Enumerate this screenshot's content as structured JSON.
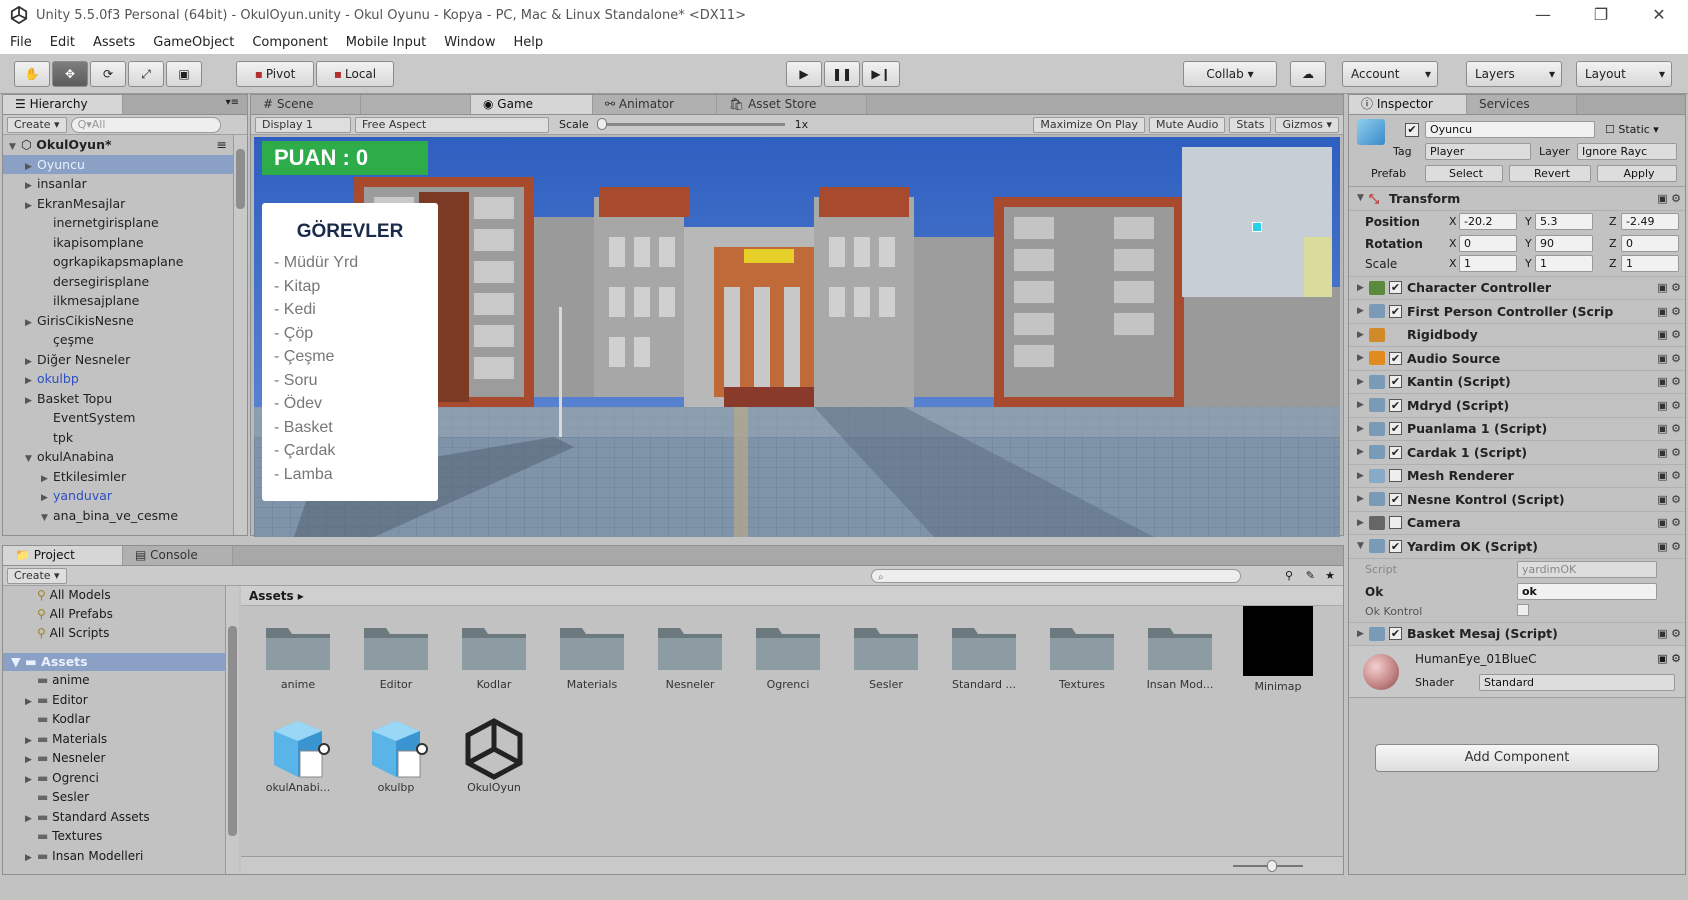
{
  "window": {
    "title": "Unity 5.5.0f3 Personal (64bit) - OkulOyun.unity - Okul Oyunu - Kopya - PC, Mac & Linux Standalone* <DX11>"
  },
  "menu": [
    "File",
    "Edit",
    "Assets",
    "GameObject",
    "Component",
    "Mobile Input",
    "Window",
    "Help"
  ],
  "toolbar": {
    "pivot": "Pivot",
    "local": "Local",
    "collab": "Collab ▾",
    "account": "Account",
    "layers": "Layers",
    "layout": "Layout"
  },
  "hierarchy": {
    "tab": "Hierarchy",
    "create": "Create ▾",
    "search_placeholder": "Q▾All",
    "root": "OkulOyun*",
    "items": [
      {
        "label": "Oyuncu",
        "tri": "▶",
        "indent": 1,
        "state": "sel"
      },
      {
        "label": "insanlar",
        "tri": "▶",
        "indent": 1,
        "state": ""
      },
      {
        "label": "EkranMesajlar",
        "tri": "▶",
        "indent": 1,
        "state": ""
      },
      {
        "label": "inernetgirisplane",
        "tri": "",
        "indent": 2,
        "state": ""
      },
      {
        "label": "ikapisomplane",
        "tri": "",
        "indent": 2,
        "state": ""
      },
      {
        "label": "ogrkapikapsmaplane",
        "tri": "",
        "indent": 2,
        "state": ""
      },
      {
        "label": "dersegirisplane",
        "tri": "",
        "indent": 2,
        "state": ""
      },
      {
        "label": "ilkmesajplane",
        "tri": "",
        "indent": 2,
        "state": ""
      },
      {
        "label": "GirisCikisNesne",
        "tri": "▶",
        "indent": 1,
        "state": ""
      },
      {
        "label": "çeşme",
        "tri": "",
        "indent": 2,
        "state": ""
      },
      {
        "label": "Diğer Nesneler",
        "tri": "▶",
        "indent": 1,
        "state": ""
      },
      {
        "label": "okulbp",
        "tri": "▶",
        "indent": 1,
        "state": "blue"
      },
      {
        "label": "Basket Topu",
        "tri": "▶",
        "indent": 1,
        "state": ""
      },
      {
        "label": "EventSystem",
        "tri": "",
        "indent": 2,
        "state": ""
      },
      {
        "label": "tpk",
        "tri": "",
        "indent": 2,
        "state": ""
      },
      {
        "label": "okulAnabina",
        "tri": "▼",
        "indent": 1,
        "state": ""
      },
      {
        "label": "Etkilesimler",
        "tri": "▶",
        "indent": 2,
        "state": ""
      },
      {
        "label": "yanduvar",
        "tri": "▶",
        "indent": 2,
        "state": "blue"
      },
      {
        "label": "ana_bina_ve_cesme",
        "tri": "▼",
        "indent": 2,
        "state": ""
      }
    ]
  },
  "sceneTabs": {
    "scene": "Scene",
    "game": "Game",
    "animator": "Animator",
    "store": "Asset Store"
  },
  "gameBar": {
    "display": "Display 1",
    "aspect": "Free Aspect",
    "scale": "Scale",
    "scale_val": "1x",
    "maximize": "Maximize On Play",
    "mute": "Mute Audio",
    "stats": "Stats",
    "gizmos": "Gizmos ▾"
  },
  "hud": {
    "score": "PUAN : 0",
    "tasks_title": "GÖREVLER",
    "tasks": [
      "- Müdür Yrd",
      "- Kitap",
      "- Kedi",
      "- Çöp",
      "- Çeşme",
      "- Soru",
      "- Ödev",
      "- Basket",
      "- Çardak",
      "- Lamba"
    ]
  },
  "project": {
    "tab": "Project",
    "console": "Console",
    "create": "Create ▾",
    "path": "Assets ▸",
    "favorites": [
      "All Models",
      "All Prefabs",
      "All Scripts"
    ],
    "assets_root": "Assets",
    "tree": [
      {
        "label": "anime",
        "tri": ""
      },
      {
        "label": "Editor",
        "tri": "▶"
      },
      {
        "label": "Kodlar",
        "tri": ""
      },
      {
        "label": "Materials",
        "tri": "▶"
      },
      {
        "label": "Nesneler",
        "tri": "▶"
      },
      {
        "label": "Ogrenci",
        "tri": "▶"
      },
      {
        "label": "Sesler",
        "tri": ""
      },
      {
        "label": "Standard Assets",
        "tri": "▶"
      },
      {
        "label": "Textures",
        "tri": ""
      },
      {
        "label": "Insan Modelleri",
        "tri": "▶"
      }
    ],
    "folders": [
      "anime",
      "Editor",
      "Kodlar",
      "Materials",
      "Nesneler",
      "Ogrenci",
      "Sesler",
      "Standard ...",
      "Textures",
      "Insan Mod..."
    ],
    "minimap_label": "Minimap",
    "row2": [
      "okulAnabi...",
      "okulbp",
      "OkulOyun"
    ]
  },
  "inspector": {
    "tab": "Inspector",
    "services": "Services",
    "name": "Oyuncu",
    "static": "Static ▾",
    "tag_label": "Tag",
    "tag": "Player",
    "layer_label": "Layer",
    "layer": "Ignore Rayc",
    "prefab_label": "Prefab",
    "select": "Select",
    "revert": "Revert",
    "apply": "Apply",
    "transform": "Transform",
    "position_label": "Position",
    "rotation_label": "Rotation",
    "scale_label": "Scale",
    "pos": {
      "x": "-20.2",
      "y": "5.3",
      "z": "-2.49"
    },
    "rot": {
      "x": "0",
      "y": "90",
      "z": "0"
    },
    "scl": {
      "x": "1",
      "y": "1",
      "z": "1"
    },
    "components": [
      {
        "label": "Character Controller",
        "color": "#5a8a3a"
      },
      {
        "label": "First Person Controller (Scrip",
        "color": "#7a9ab8"
      },
      {
        "label": "Rigidbody",
        "color": "#d08a2a"
      },
      {
        "label": "Audio Source",
        "color": "#e08a20"
      },
      {
        "label": "Kantin (Script)",
        "color": "#7a9ab8"
      },
      {
        "label": "Mdryd (Script)",
        "color": "#7a9ab8"
      },
      {
        "label": "Puanlama 1 (Script)",
        "color": "#7a9ab8"
      },
      {
        "label": "Cardak 1 (Script)",
        "color": "#7a9ab8"
      },
      {
        "label": "Mesh Renderer",
        "color": "#8aa8c8"
      },
      {
        "label": "Nesne Kontrol (Script)",
        "color": "#7a9ab8"
      },
      {
        "label": "Camera",
        "color": "#666666"
      },
      {
        "label": "Yardim OK (Script)",
        "color": "#7a9ab8"
      }
    ],
    "script_label": "Script",
    "script_val": "yardimOK",
    "ok_label": "Ok",
    "ok_val": "ok",
    "okkontrol_label": "Ok Kontrol",
    "basket": "Basket Mesaj (Script)",
    "material": "HumanEye_01BlueC",
    "shader_label": "Shader",
    "shader": "Standard",
    "add_component": "Add Component"
  }
}
